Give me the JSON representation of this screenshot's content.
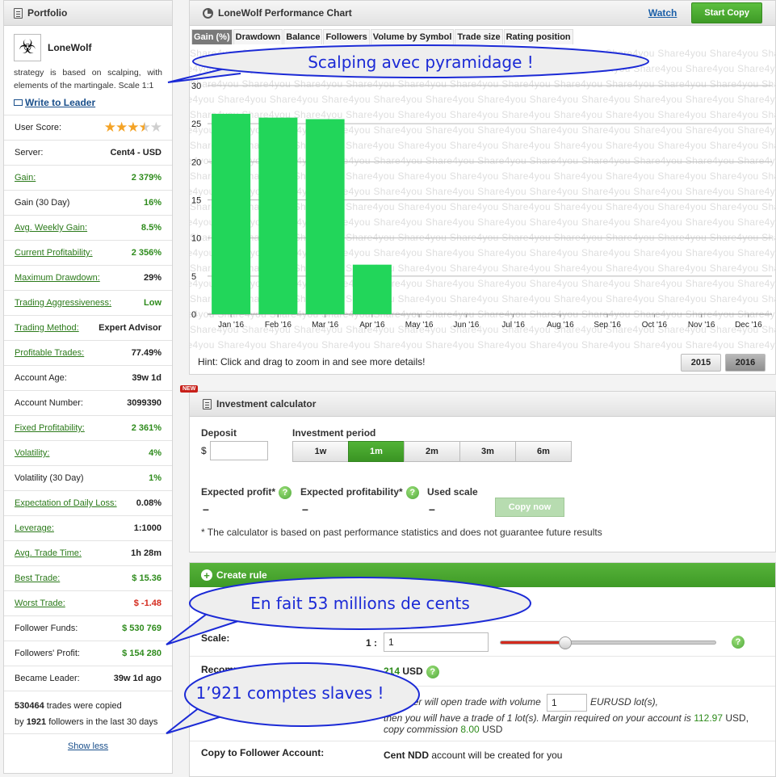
{
  "portfolio": {
    "title": "Portfolio",
    "leader_name": "LoneWolf",
    "description": "strategy is based on scalping, with elements of the martingale. Scale 1:1",
    "write_to_leader": "Write to Leader",
    "user_score_label": "User Score:",
    "user_score": 3.5,
    "stats": [
      {
        "label": "Server:",
        "value": "Cent4 - USD",
        "link": false,
        "color": "default"
      },
      {
        "label": "Gain:",
        "value": "2 379%",
        "link": true,
        "color": "green"
      },
      {
        "label": "Gain (30 Day)",
        "value": "16%",
        "link": false,
        "color": "green"
      },
      {
        "label": "Avg. Weekly Gain:",
        "value": "8.5%",
        "link": true,
        "color": "green"
      },
      {
        "label": "Current Profitability:",
        "value": "2 356%",
        "link": true,
        "color": "green"
      },
      {
        "label": "Maximum Drawdown:",
        "value": "29%",
        "link": true,
        "color": "default"
      },
      {
        "label": "Trading Aggressiveness:",
        "value": "Low",
        "link": true,
        "color": "green"
      },
      {
        "label": "Trading Method:",
        "value": "Expert Advisor",
        "link": true,
        "color": "default"
      },
      {
        "label": "Profitable Trades:",
        "value": "77.49%",
        "link": true,
        "color": "default"
      },
      {
        "label": "Account Age:",
        "value": "39w 1d",
        "link": false,
        "color": "default"
      },
      {
        "label": "Account Number:",
        "value": "3099390",
        "link": false,
        "color": "default"
      },
      {
        "label": "Fixed Profitability:",
        "value": "2 361%",
        "link": true,
        "color": "green"
      },
      {
        "label": "Volatility:",
        "value": "4%",
        "link": true,
        "color": "green"
      },
      {
        "label": "Volatility (30 Day)",
        "value": "1%",
        "link": false,
        "color": "green"
      },
      {
        "label": "Expectation of Daily Loss:",
        "value": "0.08%",
        "link": true,
        "color": "default"
      },
      {
        "label": "Leverage:",
        "value": "1:1000",
        "link": true,
        "color": "default"
      },
      {
        "label": "Avg. Trade Time:",
        "value": "1h 28m",
        "link": true,
        "color": "default"
      },
      {
        "label": "Best Trade:",
        "value": "$ 15.36",
        "link": true,
        "color": "green"
      },
      {
        "label": "Worst Trade:",
        "value": "$ -1.48",
        "link": true,
        "color": "red"
      },
      {
        "label": "Follower Funds:",
        "value": "$ 530 769",
        "link": false,
        "color": "green"
      },
      {
        "label": "Followers' Profit:",
        "value": "$ 154 280",
        "link": false,
        "color": "green"
      },
      {
        "label": "Became Leader:",
        "value": "39w 1d ago",
        "link": false,
        "color": "default"
      }
    ],
    "copied_trades": "530464",
    "copied_text_1": "trades were copied",
    "copied_by": "by",
    "copied_followers": "1921",
    "copied_text_2": "followers in the last 30 days",
    "show_less": "Show less"
  },
  "chart_panel": {
    "title": "LoneWolf Performance Chart",
    "watch": "Watch",
    "start_copy": "Start Copy",
    "tabs": [
      "Gain (%)",
      "Drawdown",
      "Balance",
      "Followers",
      "Volume by Symbol",
      "Trade size",
      "Rating position"
    ],
    "active_tab": 0,
    "watermark": "Share4you",
    "hint": "Hint: Click and drag to zoom in and see more details!",
    "years": [
      "2015",
      "2016"
    ],
    "active_year": "2016",
    "bar_color": "#22d65a"
  },
  "chart_data": {
    "type": "bar",
    "categories": [
      "Jan '16",
      "Feb '16",
      "Mar '16",
      "Apr '16",
      "May '16",
      "Jun '16",
      "Jul '16",
      "Aug '16",
      "Sep '16",
      "Oct '16",
      "Nov '16",
      "Dec '16"
    ],
    "values": [
      26.3,
      25.8,
      25.6,
      6.5,
      null,
      null,
      null,
      null,
      null,
      null,
      null,
      null
    ],
    "yticks": [
      0,
      5,
      10,
      15,
      20,
      25,
      30
    ],
    "ylim": [
      0,
      30
    ],
    "title": "",
    "xlabel": "",
    "ylabel": "",
    "grid": true
  },
  "calculator": {
    "badge": "NEW",
    "title": "Investment calculator",
    "deposit_label": "Deposit",
    "currency": "$",
    "deposit_value": "",
    "period_label": "Investment period",
    "periods": [
      "1w",
      "1m",
      "2m",
      "3m",
      "6m"
    ],
    "active_period": "1m",
    "expected_profit_label": "Expected profit*",
    "expected_profitability_label": "Expected profitability*",
    "used_scale_label": "Used scale",
    "dash": "–",
    "copy_now": "Copy now",
    "disclaimer": "* The calculator is based on past performance statistics and does not guarantee future results"
  },
  "rule": {
    "title": "Create rule",
    "scale_label": "Scale:",
    "scale_prefix": "1 :",
    "scale_value": "1",
    "slider_position": 0.3,
    "recommended_label": "Recommended:",
    "recommended_amount": "214",
    "recommended_currency": "USD",
    "line1_a": "If Leader will open trade with volume",
    "volume_value": "1",
    "line1_b": "EURUSD lot(s),",
    "line2": "then you will have a trade of 1 lot(s). Margin required on your account is",
    "margin": "112.97",
    "margin_currency": "USD,",
    "line3": "copy commission",
    "commission": "8.00",
    "commission_currency": "USD",
    "copy_to_label": "Copy to Follower Account:",
    "account_type": "Cent NDD",
    "account_text": "account will be created for you"
  },
  "annotations": {
    "bubble1": "Scalping avec pyramidage !",
    "bubble2": "En fait 53 millions de cents",
    "bubble3": "1’921 comptes slaves !",
    "bubble_color": "#1b2ad6"
  }
}
